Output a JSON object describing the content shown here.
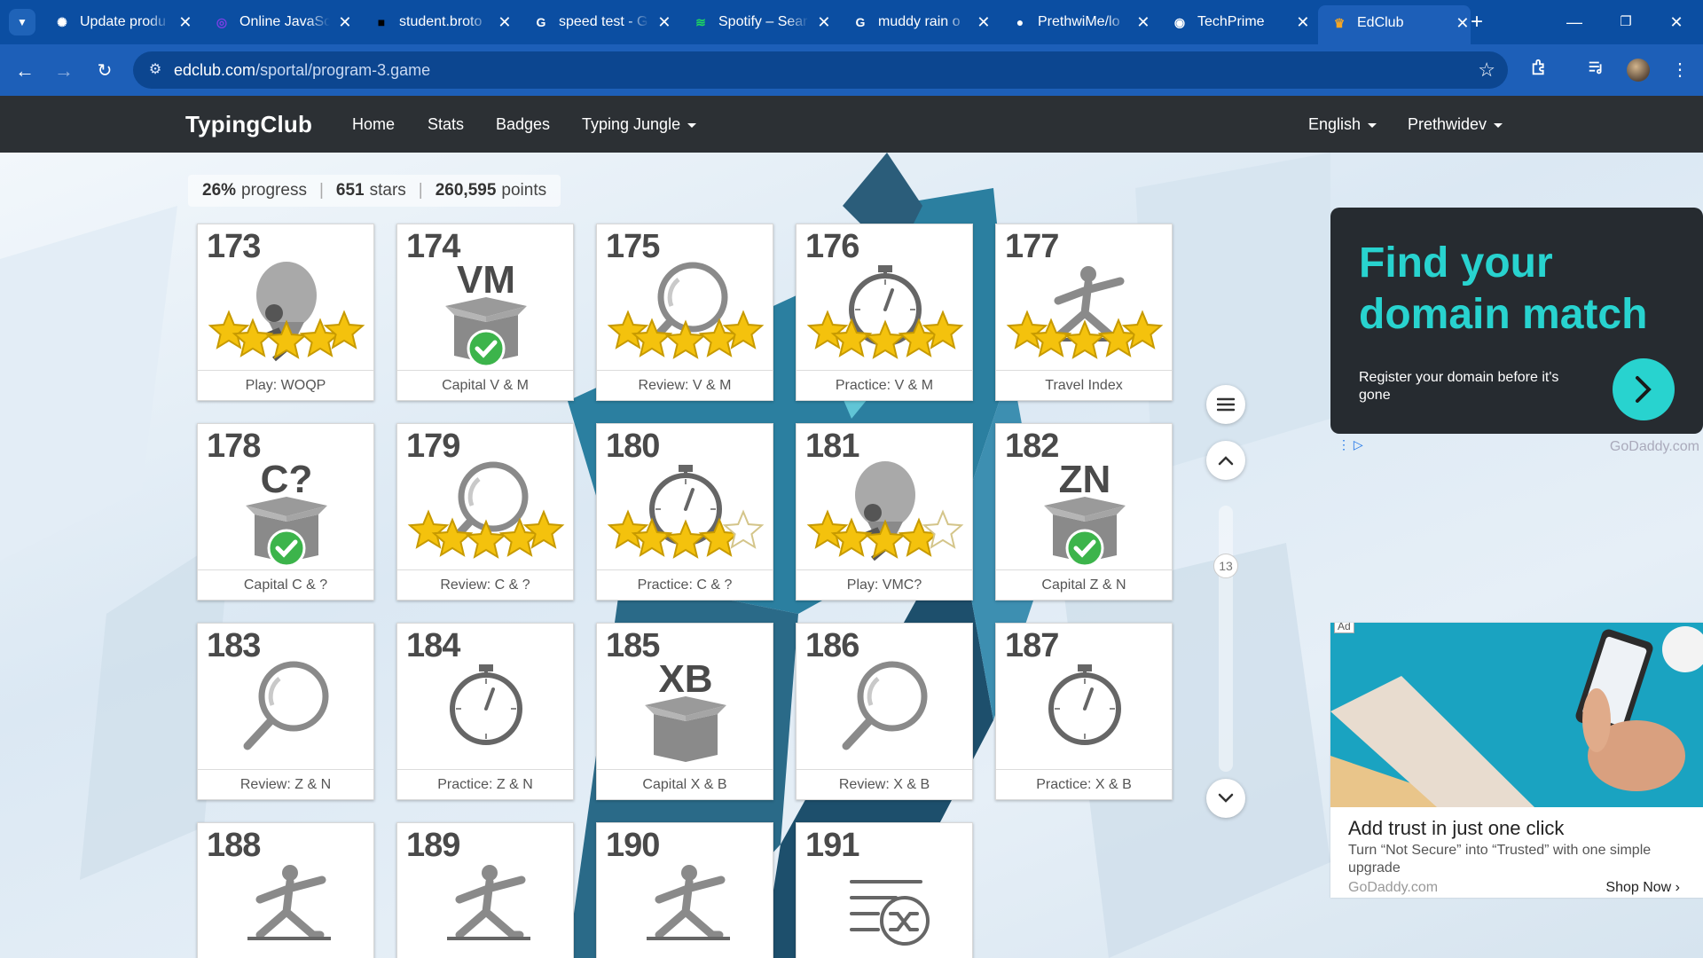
{
  "browser": {
    "tabs": [
      {
        "title": "Update produ",
        "icon": "openai-icon",
        "color": "#ffffff"
      },
      {
        "title": "Online JavaSc",
        "icon": "compiler-icon",
        "color": "#7b3fe4"
      },
      {
        "title": "student.broto",
        "icon": "broto-icon",
        "color": "#000000"
      },
      {
        "title": "speed test - G",
        "icon": "google-icon",
        "color": "#ffffff"
      },
      {
        "title": "Spotify – Sear",
        "icon": "spotify-icon",
        "color": "#1ed760"
      },
      {
        "title": "muddy rain o",
        "icon": "google-icon",
        "color": "#ffffff"
      },
      {
        "title": "PrethwiMe/lo",
        "icon": "github-icon",
        "color": "#ffffff"
      },
      {
        "title": "TechPrime",
        "icon": "techprime-icon",
        "color": "#ffffff"
      },
      {
        "title": "EdClub",
        "icon": "edclub-icon",
        "color": "#f5a623"
      }
    ],
    "url_domain": "edclub.com",
    "url_path": "/sportal/program-3.game"
  },
  "site": {
    "logo": "TypingClub",
    "nav": [
      "Home",
      "Stats",
      "Badges",
      "Typing Jungle"
    ],
    "language": "English",
    "user": "Prethwidev"
  },
  "progress": {
    "percent": "26%",
    "percent_label": "progress",
    "stars": "651",
    "stars_label": "stars",
    "points": "260,595",
    "points_label": "points"
  },
  "lessons": [
    {
      "num": "173",
      "label": "Play: WOQP",
      "icon": "balloon-icon",
      "stars": 5
    },
    {
      "num": "174",
      "label": "Capital V & M",
      "icon": "box-icon",
      "letters": "VM",
      "done": true
    },
    {
      "num": "175",
      "label": "Review: V & M",
      "icon": "magnifier-icon",
      "stars": 5
    },
    {
      "num": "176",
      "label": "Practice: V & M",
      "icon": "stopwatch-icon",
      "stars": 5
    },
    {
      "num": "177",
      "label": "Travel Index",
      "icon": "runner-icon",
      "stars": 5
    },
    {
      "num": "178",
      "label": "Capital C & ?",
      "icon": "box-icon",
      "letters": "C?",
      "done": true
    },
    {
      "num": "179",
      "label": "Review: C & ?",
      "icon": "magnifier-icon",
      "stars": 5
    },
    {
      "num": "180",
      "label": "Practice: C & ?",
      "icon": "stopwatch-icon",
      "stars": 4
    },
    {
      "num": "181",
      "label": "Play: VMC?",
      "icon": "balloon-icon",
      "stars": 4
    },
    {
      "num": "182",
      "label": "Capital Z & N",
      "icon": "box-icon",
      "letters": "ZN",
      "done": true
    },
    {
      "num": "183",
      "label": "Review: Z & N",
      "icon": "magnifier-icon",
      "stars": 0
    },
    {
      "num": "184",
      "label": "Practice: Z & N",
      "icon": "stopwatch-icon",
      "stars": 0
    },
    {
      "num": "185",
      "label": "Capital X & B",
      "icon": "box-icon",
      "letters": "XB",
      "done": false
    },
    {
      "num": "186",
      "label": "Review: X & B",
      "icon": "magnifier-icon",
      "stars": 0
    },
    {
      "num": "187",
      "label": "Practice: X & B",
      "icon": "stopwatch-icon",
      "stars": 0
    },
    {
      "num": "188",
      "label": "",
      "icon": "runner-icon",
      "stars": 0
    },
    {
      "num": "189",
      "label": "",
      "icon": "runner-icon",
      "stars": 0
    },
    {
      "num": "190",
      "label": "",
      "icon": "runner-icon",
      "stars": 0
    },
    {
      "num": "191",
      "label": "",
      "icon": "shuffle-icon",
      "stars": 0
    }
  ],
  "scroll": {
    "page": "13"
  },
  "ads": {
    "top": {
      "headline": "Find your domain match",
      "sub": "Register your domain before it's gone",
      "brand": "GoDaddy.com"
    },
    "bottom": {
      "tag": "Ad",
      "headline": "Add trust in just one click",
      "body": "Turn “Not Secure” into “Trusted” with one simple upgrade",
      "brand": "GoDaddy.com",
      "cta": "Shop Now"
    }
  },
  "colors": {
    "star": "#f4c20d",
    "check": "#3cb44b",
    "teal": "#28d3cf",
    "chrome": "#0b4ea2"
  }
}
